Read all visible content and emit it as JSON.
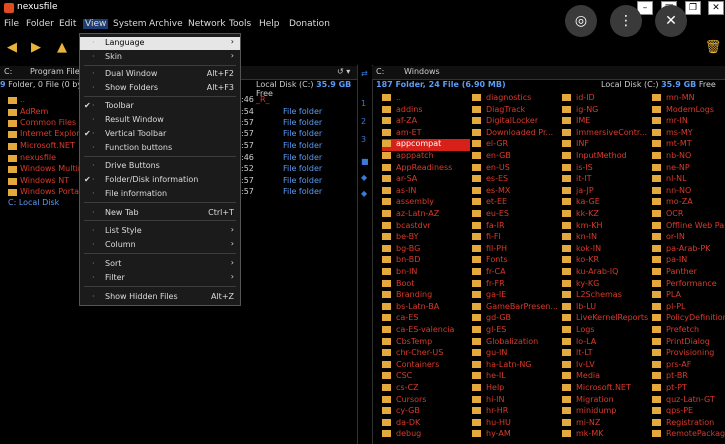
{
  "window": {
    "title": "nexusfile"
  },
  "menubar": [
    "File",
    "Folder",
    "Edit",
    "View",
    "System",
    "Archive",
    "Network",
    "Tools",
    "Help",
    "Donation"
  ],
  "left_panel": {
    "path": "C:",
    "path_folder": "Program Files (",
    "info_count": "9",
    "info_rest": " Folder, 0 File (0 byte",
    "disk_label": "Local Disk (C:)",
    "disk_free": "35.9 GB",
    "disk_suffix": "Free",
    "drive_item": "C: Local Disk",
    "files": [
      "..",
      "AdRem",
      "Common Files",
      "Internet Explorer",
      "Microsoft.NET",
      "nexusfile",
      "Windows Multim",
      "Windows NT",
      "Windows Portab"
    ],
    "times": [
      ":46",
      ":54",
      ":57",
      ":57",
      ":57",
      ":46",
      ":52",
      ":57",
      ":57"
    ],
    "types": [
      "_R_",
      "File folder",
      "File folder",
      "File folder",
      "File folder",
      "File folder",
      "File folder",
      "File folder",
      "File folder"
    ]
  },
  "right_panel": {
    "path": "C:",
    "path_folder": "Windows",
    "info_count": "187",
    "info_rest": " Folder, ",
    "info_files": "24",
    "info_rest2": " File (6.90 MB)",
    "disk_label": "Local Disk (C:)",
    "disk_free": "35.9 GB",
    "disk_suffix": "Free",
    "selected": "appcompat",
    "columns": [
      [
        "..",
        "addins",
        "af-ZA",
        "am-ET",
        "appcompat",
        "apppatch",
        "AppReadiness",
        "ar-SA",
        "as-IN",
        "assembly",
        "az-Latn-AZ",
        "bcastdvr",
        "be-BY",
        "bg-BG",
        "bn-BD",
        "bn-IN",
        "Boot",
        "Branding",
        "bs-Latn-BA",
        "ca-ES",
        "ca-ES-valencia",
        "CbsTemp",
        "chr-Cher-US",
        "Containers",
        "CSC",
        "cs-CZ",
        "Cursors",
        "cy-GB",
        "da-DK",
        "debug"
      ],
      [
        "diagnostics",
        "DiagTrack",
        "DigitalLocker",
        "Downloaded Pr...",
        "el-GR",
        "en-GB",
        "en-US",
        "es-ES",
        "es-MX",
        "et-EE",
        "eu-ES",
        "fa-IR",
        "fi-FI",
        "fil-PH",
        "Fonts",
        "fr-CA",
        "fr-FR",
        "ga-IE",
        "GameBarPresen...",
        "gd-GB",
        "gl-ES",
        "Globalization",
        "gu-IN",
        "ha-Latn-NG",
        "he-IL",
        "Help",
        "hi-IN",
        "hr-HR",
        "hu-HU",
        "hy-AM"
      ],
      [
        "id-ID",
        "ig-NG",
        "IME",
        "ImmersiveContr...",
        "INF",
        "InputMethod",
        "is-IS",
        "it-IT",
        "ja-JP",
        "ka-GE",
        "kk-KZ",
        "km-KH",
        "kn-IN",
        "kok-IN",
        "ko-KR",
        "ku-Arab-IQ",
        "ky-KG",
        "L2Schemas",
        "lb-LU",
        "LiveKernelReports",
        "Logs",
        "lo-LA",
        "lt-LT",
        "lv-LV",
        "Media",
        "Microsoft.NET",
        "Migration",
        "minidump",
        "mi-NZ",
        "mk-MK"
      ],
      [
        "mn-MN",
        "ModemLogs",
        "mr-IN",
        "ms-MY",
        "mt-MT",
        "nb-NO",
        "ne-NP",
        "nl-NL",
        "nn-NO",
        "mo-ZA",
        "OCR",
        "Offline Web Pa...",
        "or-IN",
        "pa-Arab-PK",
        "pa-IN",
        "Panther",
        "Performance",
        "PLA",
        "pl-PL",
        "PolicyDefinitions",
        "Prefetch",
        "PrintDialog",
        "Provisioning",
        "prs-AF",
        "pt-BR",
        "pt-PT",
        "quz-Latn-GT",
        "qps-PE",
        "Registration",
        "RemotePackage"
      ]
    ]
  },
  "view_menu": [
    {
      "key": "language",
      "label": "Language",
      "arrow": "›",
      "check": "",
      "shortcut": ""
    },
    {
      "key": "skin",
      "label": "Skin",
      "arrow": "›",
      "check": "",
      "shortcut": ""
    },
    {
      "key": "dual",
      "label": "Dual Window",
      "arrow": "",
      "check": "",
      "shortcut": "Alt+F2"
    },
    {
      "key": "showfolders",
      "label": "Show Folders",
      "arrow": "",
      "check": "",
      "shortcut": "Alt+F3"
    },
    {
      "key": "toolbar",
      "label": "Toolbar",
      "arrow": "",
      "check": "✔",
      "shortcut": ""
    },
    {
      "key": "result",
      "label": "Result Window",
      "arrow": "",
      "check": "",
      "shortcut": ""
    },
    {
      "key": "vtoolbar",
      "label": "Vertical Toolbar",
      "arrow": "",
      "check": "✔",
      "shortcut": ""
    },
    {
      "key": "funcbtns",
      "label": "Function buttons",
      "arrow": "",
      "check": "",
      "shortcut": ""
    },
    {
      "key": "drivebtns",
      "label": "Drive Buttons",
      "arrow": "",
      "check": "",
      "shortcut": ""
    },
    {
      "key": "diskinfo",
      "label": "Folder/Disk information",
      "arrow": "",
      "check": "✔",
      "shortcut": ""
    },
    {
      "key": "fileinfo",
      "label": "File information",
      "arrow": "",
      "check": "",
      "shortcut": ""
    },
    {
      "key": "newtab",
      "label": "New Tab",
      "arrow": "",
      "check": "",
      "shortcut": "Ctrl+T"
    },
    {
      "key": "liststyle",
      "label": "List Style",
      "arrow": "›",
      "check": "",
      "shortcut": ""
    },
    {
      "key": "column",
      "label": "Column",
      "arrow": "›",
      "check": "",
      "shortcut": ""
    },
    {
      "key": "sort",
      "label": "Sort",
      "arrow": "›",
      "check": "",
      "shortcut": ""
    },
    {
      "key": "filter",
      "label": "Filter",
      "arrow": "›",
      "check": "",
      "shortcut": ""
    },
    {
      "key": "hidden",
      "label": "Show Hidden Files",
      "arrow": "",
      "check": "",
      "shortcut": "Alt+Z"
    }
  ],
  "colors": {
    "file_red": "#d93a2b",
    "selected": "#d8201a",
    "accent_blue": "#5b9cf4",
    "folder": "#e4a93c"
  }
}
